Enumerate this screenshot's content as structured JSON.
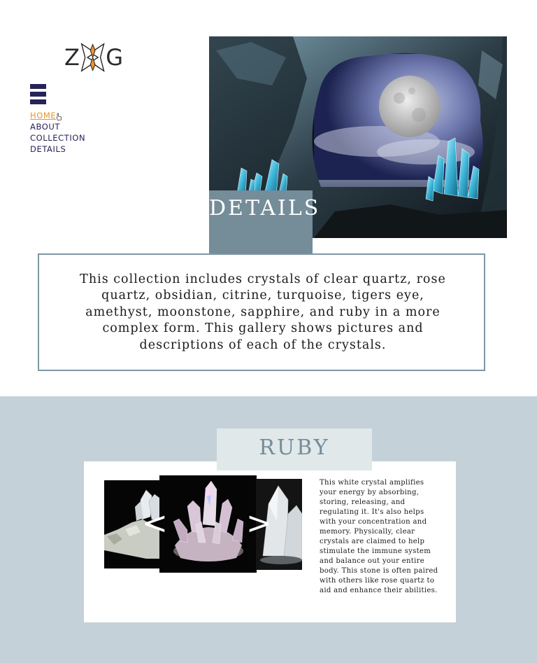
{
  "logo": {
    "left_letter": "Z",
    "right_letter": "G"
  },
  "nav": {
    "items": [
      "HOME",
      "ABOUT",
      "COLLECTION",
      "DETAILS"
    ],
    "active": "HOME"
  },
  "hero": {
    "heading": "DETAILS",
    "description": "This collection includes crystals of clear quartz, rose quartz, obsidian, citrine, turquoise, tigers eye, amethyst, moonstone, sapphire, and ruby in a more complex form. This gallery shows pictures and descriptions of each of the crystals."
  },
  "gallery": {
    "title": "RUBY",
    "prev_label": "<",
    "next_label": ">",
    "description": "This white crystal amplifies your energy by absorbing, storing, releasing, and regulating it. It's also helps with your concentration and memory. Physically, clear crystals are claimed to help stimulate the immune system and balance out your entire body. This stone is often paired with others like rose quartz to aid and enhance their abilities."
  },
  "colors": {
    "nav_text": "#262359",
    "nav_active": "#e8962e",
    "accent_slate": "#758c99",
    "section_bg": "#c4d1d8",
    "logo_orange": "#f0922b"
  }
}
